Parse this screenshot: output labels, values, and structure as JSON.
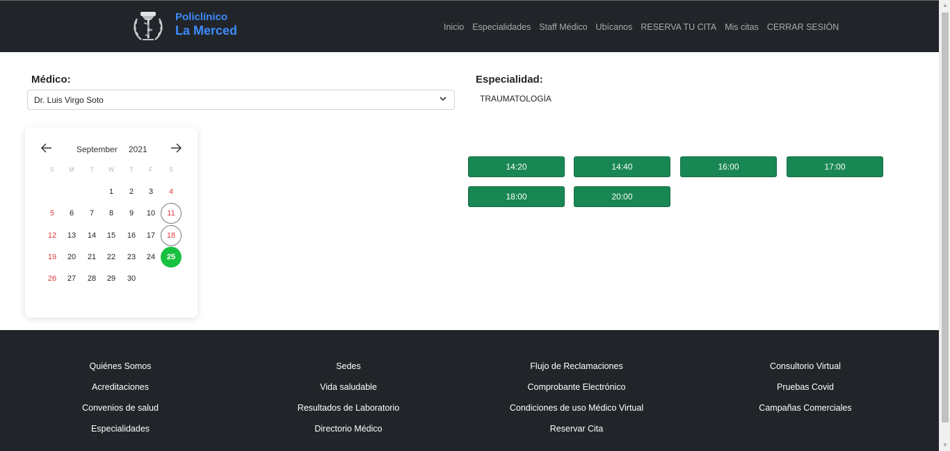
{
  "brand": {
    "line1": "Policlínico",
    "line2": "La Merced",
    "logo_icon": "caduceus-laurel-icon"
  },
  "nav": {
    "items": [
      "Inicio",
      "Especialidades",
      "Staff Médico",
      "Ubícanos",
      "RESERVA TU CITA",
      "Mis citas",
      "CERRAR SESIÓN"
    ]
  },
  "form": {
    "medico_label": "Médico:",
    "medico_value": "Dr. Luis Virgo Soto",
    "especialidad_label": "Especialidad:",
    "especialidad_value": "TRAUMATOLOGÍA"
  },
  "calendar": {
    "month": "September",
    "year": "2021",
    "weekdays": [
      "S",
      "M",
      "T",
      "W",
      "T",
      "F",
      "S"
    ],
    "weeks": [
      [
        "",
        "",
        "",
        "1",
        "2",
        "3",
        "4"
      ],
      [
        "5",
        "6",
        "7",
        "8",
        "9",
        "10",
        "11"
      ],
      [
        "12",
        "13",
        "14",
        "15",
        "16",
        "17",
        "18"
      ],
      [
        "19",
        "20",
        "21",
        "22",
        "23",
        "24",
        "25"
      ],
      [
        "26",
        "27",
        "28",
        "29",
        "30",
        "",
        ""
      ]
    ],
    "circled_days": [
      "11",
      "18"
    ],
    "selected_day": "25",
    "colors": {
      "weekend": "#e0393e",
      "selected": "#19c140"
    }
  },
  "slots": [
    "14:20",
    "14:40",
    "16:00",
    "17:00",
    "18:00",
    "20:00"
  ],
  "footer": {
    "col1": [
      "Quiénes Somos",
      "Acreditaciones",
      "Convenios de salud",
      "Especialidades"
    ],
    "col2": [
      "Sedes",
      "Vida saludable",
      "Resultados de Laboratorio",
      "Directorio Médico"
    ],
    "col3": [
      "Flujo de Reclamaciones",
      "Comprobante Electrónico",
      "Condiciones de uso Médico Virtual",
      "Reservar Cita"
    ],
    "col4": [
      "Consultorio Virtual",
      "Pruebas Covid",
      "Campañas Comerciales"
    ]
  },
  "colors": {
    "header_bg": "#212529",
    "brand_blue": "#3d8bfd",
    "slot_green": "#198754"
  }
}
